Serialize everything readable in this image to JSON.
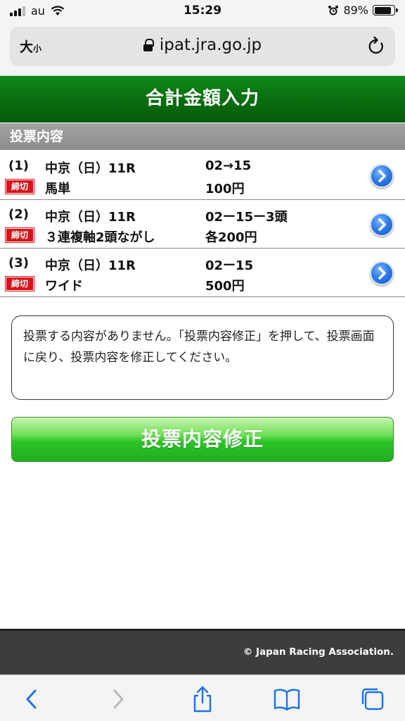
{
  "status_bar": {
    "carrier": "au",
    "time": "15:29",
    "battery_percent": "89%",
    "battery_level": 0.89
  },
  "browser": {
    "text_size_big": "大",
    "text_size_small": "小",
    "url": "ipat.jra.go.jp"
  },
  "page": {
    "title": "合計金額入力",
    "section_title": "投票内容",
    "bets": [
      {
        "number": "(1)",
        "deadline_badge": "締切",
        "race": "中京（日）11R",
        "bet_type": "馬単",
        "combination": "02→15",
        "amount": "100円"
      },
      {
        "number": "(2)",
        "deadline_badge": "締切",
        "race": "中京（日）11R",
        "bet_type": "３連複軸2頭ながし",
        "combination": "02ー15ー3頭",
        "amount": "各200円"
      },
      {
        "number": "(3)",
        "deadline_badge": "締切",
        "race": "中京（日）11R",
        "bet_type": "ワイド",
        "combination": "02ー15",
        "amount": "500円"
      }
    ],
    "message": "投票する内容がありません。「投票内容修正」を押して、投票画面に戻り、投票内容を修正してください。",
    "modify_button": "投票内容修正"
  },
  "footer": {
    "copyright": "© Japan Racing Association."
  },
  "icons": {
    "bet_detail": "chevron-right-circle-icon",
    "toolbar": [
      "back-icon",
      "forward-icon",
      "share-icon",
      "bookmarks-icon",
      "tabs-icon"
    ]
  },
  "colors": {
    "header_green": "#0a7010",
    "deadline_red": "#d8121a",
    "button_green": "#2cc42a",
    "ios_blue": "#1a73e8"
  }
}
